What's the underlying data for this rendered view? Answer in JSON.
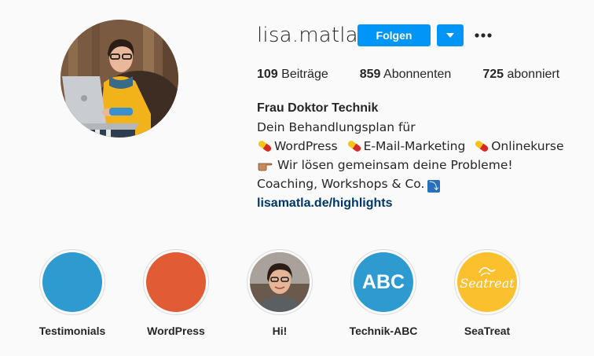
{
  "profile": {
    "username": "lisa.matla",
    "follow_label": "Folgen",
    "stats": {
      "posts_count": "109",
      "posts_label": "Beiträge",
      "followers_count": "859",
      "followers_label": "Abonnenten",
      "following_count": "725",
      "following_label": "abonniert"
    },
    "bio": {
      "name": "Frau Doktor Technik",
      "line1": "Dein Behandlungsplan für",
      "topic1": "WordPress",
      "topic2": "E-Mail-Marketing",
      "topic3": "Onlinekurse",
      "line3": "Wir lösen gemeinsam deine Probleme!",
      "line4": "Coaching, Workshops & Co.",
      "link": "lisamatla.de/highlights"
    }
  },
  "highlights": [
    {
      "label": "Testimonials",
      "color": "#2e9bd0"
    },
    {
      "label": "WordPress",
      "color": "#e15b35"
    },
    {
      "label": "Hi!",
      "color": "#6a5a4e"
    },
    {
      "label": "Technik-ABC",
      "color": "#2e9bd0",
      "text": "ABC"
    },
    {
      "label": "SeaTreat",
      "color": "#fbc02d",
      "text": "Seatreat"
    }
  ],
  "colors": {
    "accent": "#0095f6",
    "link": "#00376b",
    "background": "#fafafa"
  },
  "icons": [
    "chevron-down-icon",
    "more-icon",
    "pill-icon",
    "pointing-hand-icon",
    "down-arrow-icon"
  ]
}
